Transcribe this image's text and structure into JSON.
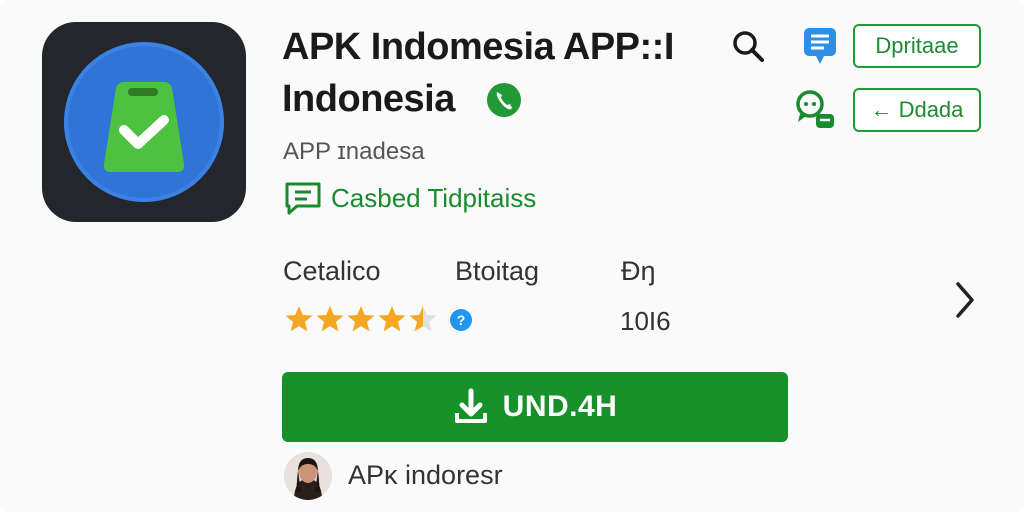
{
  "app": {
    "title_line1": "APK Indomesia APP::I",
    "title_line2": "Indonesia",
    "developer": "APP ɪnadesa",
    "tag_label": "Casbed Tidpitaiss"
  },
  "actions": {
    "primary_side_button": "Dpritaae",
    "secondary_side_button": "Ddada",
    "secondary_side_arrow": "←"
  },
  "stats": {
    "col1_label": "Cetalico",
    "col2_label": "Btoitag",
    "col3_label": "Đŋ",
    "col3_value": "10I6",
    "rating": 4.5,
    "info_glyph": "?"
  },
  "install": {
    "label": "UND.4H"
  },
  "footer": {
    "name": "APĸ indoresr"
  },
  "colors": {
    "accent_green": "#17922b",
    "icon_blue": "#2f74d6",
    "star_gold": "#f5a623"
  },
  "icons": [
    "search-icon",
    "verified-phone-icon",
    "chat-bubble-icon",
    "group-chat-icon",
    "info-icon",
    "chevron-right-icon",
    "download-icon"
  ]
}
